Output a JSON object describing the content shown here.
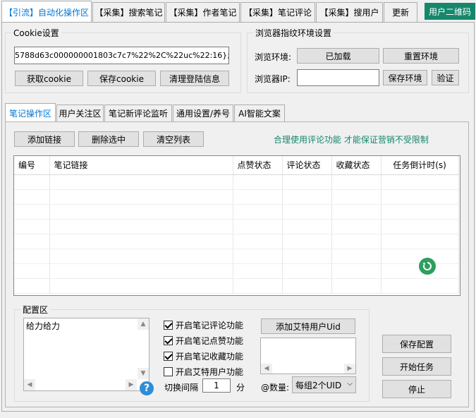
{
  "top_tabs": [
    {
      "label": "【引流】自动化操作区",
      "active": true
    },
    {
      "label": "【采集】搜索笔记"
    },
    {
      "label": "【采集】作者笔记"
    },
    {
      "label": "【采集】笔记评论"
    },
    {
      "label": "【采集】搜用户"
    },
    {
      "label": "更新"
    }
  ],
  "qr_button": "用户二维码",
  "cookie": {
    "legend": "Cookie设置",
    "value": "5788d63c000000001803c7c7%22%2C%22uc%22:16};",
    "get_btn": "获取cookie",
    "save_btn": "保存cookie",
    "clear_btn": "清理登陆信息"
  },
  "browser": {
    "legend": "浏览器指纹环境设置",
    "env_label": "浏览环境:",
    "env_status": "已加载",
    "reset_btn": "重置环境",
    "ip_label": "浏览器IP:",
    "ip_value": "",
    "save_env_btn": "保存环境",
    "verify_btn": "验证"
  },
  "inner_tabs": [
    {
      "label": "笔记操作区",
      "active": true
    },
    {
      "label": "用户关注区"
    },
    {
      "label": "笔记新评论监听"
    },
    {
      "label": "通用设置/养号"
    },
    {
      "label": "AI智能文案"
    }
  ],
  "toolbar": {
    "add_link": "添加链接",
    "delete_selected": "删除选中",
    "clear_list": "清空列表",
    "notice": "合理使用评论功能 才能保证营销不受限制"
  },
  "table": {
    "columns": [
      "编号",
      "笔记链接",
      "点赞状态",
      "评论状态",
      "收藏状态",
      "任务倒计时(s)"
    ]
  },
  "config": {
    "legend": "配置区",
    "comment_text": "给力给力",
    "enable_comment": "开启笔记评论功能",
    "enable_like": "开启笔记点赞功能",
    "enable_collect": "开启笔记收藏功能",
    "enable_at": "开启艾特用户功能",
    "checks": [
      true,
      true,
      true,
      false
    ],
    "interval_label": "切换间隔",
    "interval_value": "1",
    "interval_unit": "分",
    "add_at_uid_btn": "添加艾特用户Uid",
    "at_count_label": "@数量:",
    "at_count_value": "每组2个UID"
  },
  "actions": {
    "save_config": "保存配置",
    "start_task": "开始任务",
    "stop": "停止"
  }
}
